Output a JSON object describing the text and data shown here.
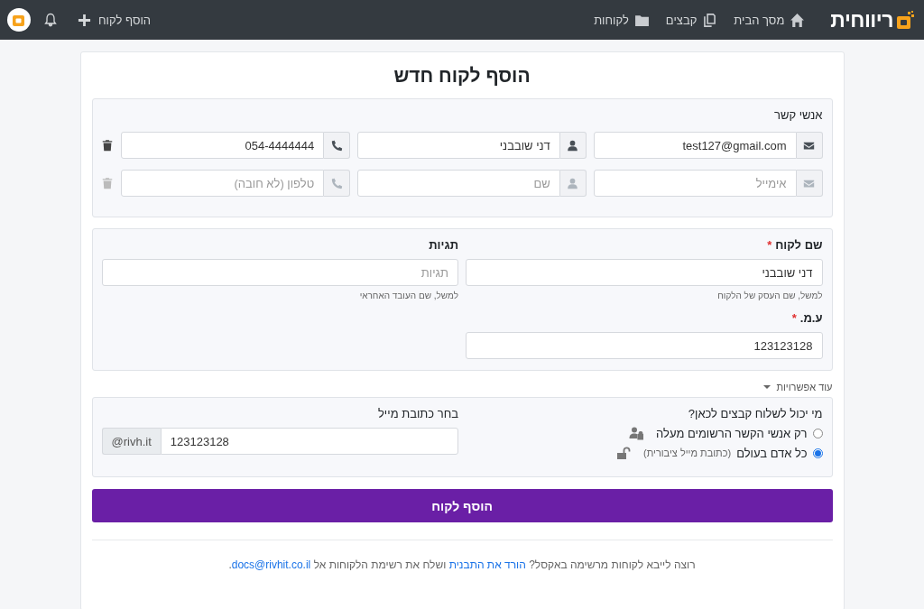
{
  "navbar": {
    "logo": "ריווחית",
    "items": [
      {
        "label": "מסך הבית"
      },
      {
        "label": "קבצים"
      },
      {
        "label": "לקוחות"
      }
    ],
    "add_button": "הוסף לקוח"
  },
  "title": "הוסף לקוח חדש",
  "contacts": {
    "label": "אנשי קשר",
    "rows": [
      {
        "email": {
          "value": "test127@gmail.com"
        },
        "name": {
          "value": "דני שובבני"
        },
        "phone": {
          "value": "054-4444444"
        },
        "delete_disabled": false
      },
      {
        "email": {
          "placeholder": "אימייל"
        },
        "name": {
          "placeholder": "שם"
        },
        "phone": {
          "placeholder": "טלפון (לא חובה)"
        },
        "delete_disabled": true
      }
    ]
  },
  "customer": {
    "name_label": "שם לקוח",
    "name_required_mark": "*",
    "name_value": "דני שובבני",
    "name_hint": "למשל, שם העסק של הלקוח",
    "tags_label": "תגיות",
    "tags_placeholder": "תגיות",
    "tags_hint": "למשל, שם העובד האחראי",
    "id_label": "ע.מ.",
    "id_required_mark": "*",
    "id_value": "123123128"
  },
  "more_options": {
    "label": "עוד אפשרויות",
    "expanded": false
  },
  "sharing": {
    "question": "מי יכול לשלוח קבצים לכאן?",
    "options": [
      {
        "label": "רק אנשי הקשר הרשומים מעלה",
        "selected": false
      },
      {
        "label": "כל אדם בעולם",
        "note": "(כתובת מייל ציבורית)",
        "selected": true
      }
    ],
    "email_label": "בחר כתובת מייל",
    "email_suffix": "@rivh.it",
    "email_value": "123123128"
  },
  "submit": "הוסף לקוח",
  "footer": {
    "text_before": "רוצה לייבא לקוחות מרשימה באקסל?",
    "template_link": "הורד את התבנית",
    "text_middle": "ושלח את רשימת הלקוחות אל",
    "email_link": "docs@rivhit.co.il",
    "text_end": "."
  }
}
